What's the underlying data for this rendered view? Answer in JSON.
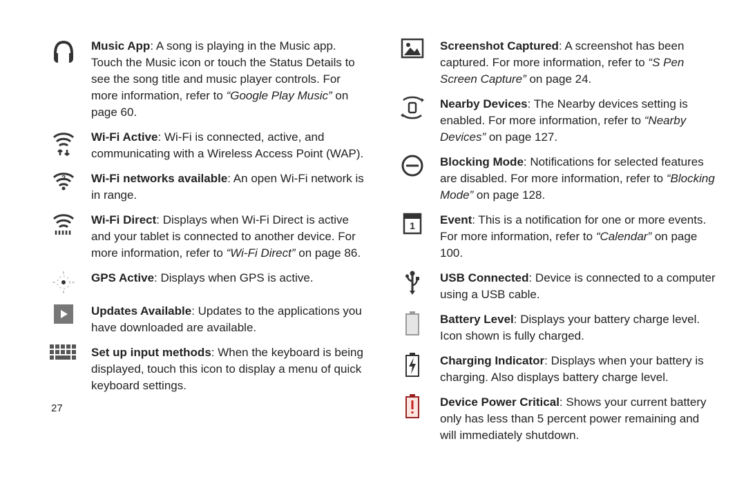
{
  "page_number": "27",
  "left": [
    {
      "title": "Music App",
      "body": ": A song is playing in the Music app. Touch the Music icon or touch the Status Details to see the song title and music player controls. For more information, refer to ",
      "ref": "“Google Play Music”",
      "tail": " on page 60."
    },
    {
      "title": "Wi-Fi Active",
      "body": ": Wi-Fi is connected, active, and communicating with a Wireless Access Point (WAP)."
    },
    {
      "title": "Wi-Fi networks available",
      "body": ": An open Wi-Fi network is in range."
    },
    {
      "title": "Wi-Fi Direct",
      "body": ": Displays when Wi-Fi Direct is active and your tablet is connected to another device. For more information, refer to ",
      "ref": "“Wi-Fi Direct”",
      "tail": " on page 86."
    },
    {
      "title": "GPS Active",
      "body": ": Displays when GPS is active."
    },
    {
      "title": "Updates Available",
      "body": ": Updates to the applications you have downloaded are available."
    },
    {
      "title": "Set up input methods",
      "body": ": When the keyboard is being displayed, touch this icon to display a menu of quick keyboard settings."
    }
  ],
  "right": [
    {
      "title": "Screenshot Captured",
      "body": ": A screenshot has been captured. For more information, refer to ",
      "ref": "“S Pen Screen Capture”",
      "tail": " on page 24."
    },
    {
      "title": "Nearby Devices",
      "body": ": The Nearby devices setting is enabled. For more information, refer to ",
      "ref": "“Nearby Devices”",
      "tail": " on page 127."
    },
    {
      "title": "Blocking Mode",
      "body": ": Notifications for selected features are disabled. For more information, refer to ",
      "ref": "“Blocking Mode”",
      "tail": " on page 128."
    },
    {
      "title": "Event",
      "body": ": This is a notification for one or more events. For more information, refer to ",
      "ref": "“Calendar”",
      "tail": " on page 100."
    },
    {
      "title": "USB Connected",
      "body": ": Device is connected to a computer using a USB cable."
    },
    {
      "title": "Battery Level",
      "body": ": Displays your battery charge level. Icon shown is fully charged."
    },
    {
      "title": "Charging Indicator",
      "body": ": Displays when your battery is charging. Also displays battery charge level."
    },
    {
      "title": "Device Power Critical",
      "body": ": Shows your current battery only has less than 5 percent power remaining and will immediately shutdown."
    }
  ]
}
